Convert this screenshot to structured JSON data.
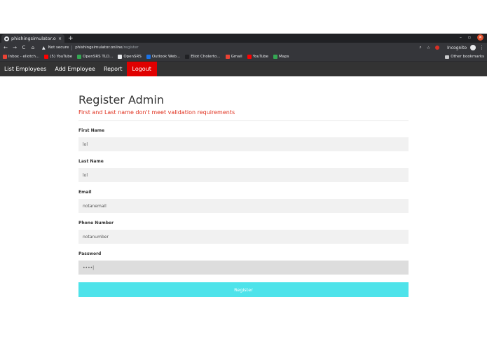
{
  "browser": {
    "tab": {
      "title": "phishingsimulator.online/register",
      "close": "×"
    },
    "new_tab": "+",
    "window_controls": {
      "minimize": "–",
      "maximize": "▫",
      "close": "✕"
    },
    "toolbar": {
      "back": "←",
      "forward": "→",
      "reload": "C",
      "home": "⌂",
      "security_label": "Not secure",
      "url_host": "phishingsimulator.online",
      "url_path": "/register",
      "search": "⌕",
      "star": "☆",
      "profile": "Incognito",
      "menu": "⋮"
    },
    "bookmarks": [
      {
        "label": "Inbox - eliotch...",
        "color": "#ea4335"
      },
      {
        "label": "(5) YouTube",
        "color": "#ff0000"
      },
      {
        "label": "OpenSRS TLD...",
        "color": "#34a853"
      },
      {
        "label": "OpenSRS",
        "color": "#e8eaed"
      },
      {
        "label": "Outlook Web...",
        "color": "#1a73e8"
      },
      {
        "label": "Eliot Cholerto...",
        "color": "#202124"
      },
      {
        "label": "Gmail",
        "color": "#ea4335"
      },
      {
        "label": "YouTube",
        "color": "#ff0000"
      },
      {
        "label": "Maps",
        "color": "#34a853"
      }
    ],
    "other_bookmarks": "Other bookmarks"
  },
  "nav": {
    "list_employees": "List Employees",
    "add_employee": "Add Employee",
    "report": "Report",
    "logout": "Logout"
  },
  "form": {
    "title": "Register Admin",
    "error": "First and Last name don't meet validation requirements",
    "fields": {
      "first_name": {
        "label": "First Name",
        "value": "lol"
      },
      "last_name": {
        "label": "Last Name",
        "value": "lol"
      },
      "email": {
        "label": "Email",
        "value": "notanemail"
      },
      "phone": {
        "label": "Phone Number",
        "value": "notanumber"
      },
      "password": {
        "label": "Password",
        "value": "••••|"
      }
    },
    "submit_label": "Register"
  },
  "colors": {
    "accent": "#4ee3ea",
    "logout": "#e00000",
    "error": "#e0301e",
    "navbar": "#333333"
  }
}
